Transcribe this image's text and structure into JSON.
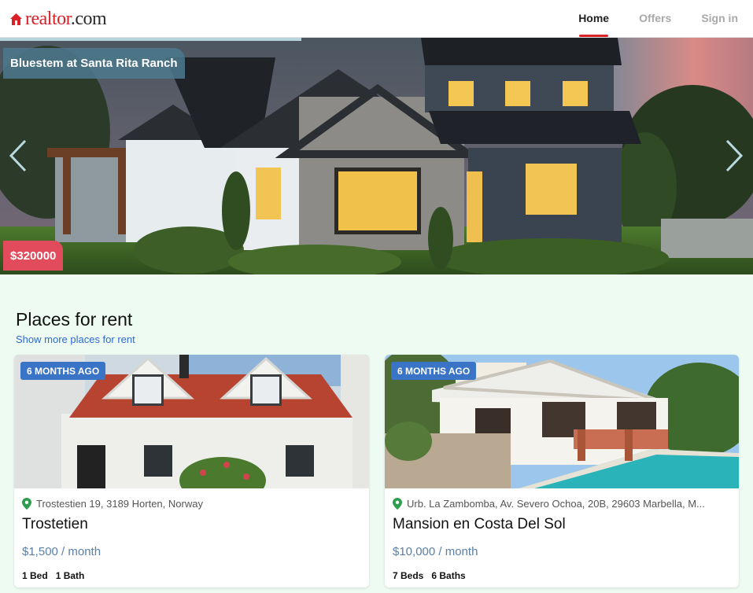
{
  "header": {
    "logo_part1": "realtor",
    "logo_part2": ".com",
    "nav": [
      {
        "label": "Home",
        "active": true
      },
      {
        "label": "Offers",
        "active": false
      },
      {
        "label": "Sign in",
        "active": false
      }
    ]
  },
  "hero": {
    "title": "Bluestem at Santa Rita Ranch",
    "price": "$320000",
    "prev_icon": "chevron-left-icon",
    "next_icon": "chevron-right-icon"
  },
  "section": {
    "title": "Places for rent",
    "link": "Show more places for rent"
  },
  "listings": [
    {
      "badge": "6 MONTHS AGO",
      "address": "Trostestien 19, 3189 Horten, Norway",
      "name": "Trostetien",
      "price": "$1,500 / month",
      "beds": "1 Bed",
      "baths": "1 Bath"
    },
    {
      "badge": "6 MONTHS AGO",
      "address": "Urb. La Zambomba, Av. Severo Ochoa, 20B, 29603 Marbella, M...",
      "name": "Mansion en Costa Del Sol",
      "price": "$10,000 / month",
      "beds": "7 Beds",
      "baths": "6 Baths"
    }
  ],
  "colors": {
    "brand_red": "#d92228",
    "accent_blue": "#3a74c7",
    "price_badge": "#e24b5c",
    "page_bg": "#eefbf3"
  }
}
